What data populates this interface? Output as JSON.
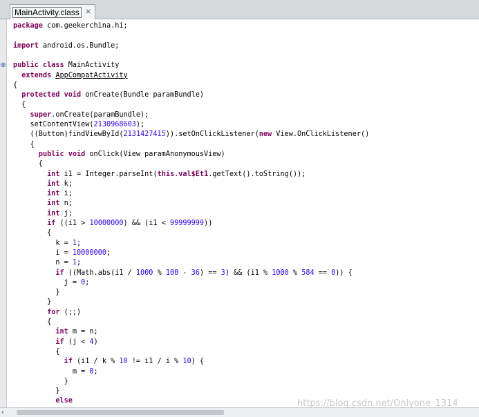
{
  "tab": {
    "title": "MainActivity.class",
    "close_glyph": "×"
  },
  "code": [
    [
      [
        "kw",
        "package"
      ],
      [
        "plain",
        " com.geekerchina.hi;"
      ]
    ],
    [],
    [
      [
        "kw",
        "import"
      ],
      [
        "plain",
        " android.os.Bundle;"
      ]
    ],
    [],
    [
      [
        "kw",
        "public class"
      ],
      [
        "plain",
        " MainActivity"
      ]
    ],
    [
      [
        "plain",
        "  "
      ],
      [
        "kw",
        "extends"
      ],
      [
        "plain",
        " "
      ],
      [
        "under",
        "AppCompatActivity"
      ]
    ],
    [
      [
        "plain",
        "{"
      ]
    ],
    [
      [
        "plain",
        "  "
      ],
      [
        "kw",
        "protected void"
      ],
      [
        "plain",
        " onCreate(Bundle paramBundle)"
      ]
    ],
    [
      [
        "plain",
        "  {"
      ]
    ],
    [
      [
        "plain",
        "    "
      ],
      [
        "kw",
        "super"
      ],
      [
        "plain",
        ".onCreate(paramBundle);"
      ]
    ],
    [
      [
        "plain",
        "    setContentView("
      ],
      [
        "num",
        "2130968603"
      ],
      [
        "plain",
        ");"
      ]
    ],
    [
      [
        "plain",
        "    ((Button)findViewById("
      ],
      [
        "num",
        "2131427415"
      ],
      [
        "plain",
        ")).setOnClickListener("
      ],
      [
        "kw",
        "new"
      ],
      [
        "plain",
        " View.OnClickListener()"
      ]
    ],
    [
      [
        "plain",
        "    {"
      ]
    ],
    [
      [
        "plain",
        "      "
      ],
      [
        "kw",
        "public void"
      ],
      [
        "plain",
        " onClick(View paramAnonymousView)"
      ]
    ],
    [
      [
        "plain",
        "      {"
      ]
    ],
    [
      [
        "plain",
        "        "
      ],
      [
        "kw",
        "int"
      ],
      [
        "plain",
        " i1 = Integer."
      ],
      [
        "plain",
        "parseInt"
      ],
      [
        "plain",
        "("
      ],
      [
        "kw",
        "this"
      ],
      [
        "plain",
        "."
      ],
      [
        "kw",
        "val$Et1"
      ],
      [
        "plain",
        ".getText().toString());"
      ]
    ],
    [
      [
        "plain",
        "        "
      ],
      [
        "kw",
        "int"
      ],
      [
        "plain",
        " k;"
      ]
    ],
    [
      [
        "plain",
        "        "
      ],
      [
        "kw",
        "int"
      ],
      [
        "plain",
        " i;"
      ]
    ],
    [
      [
        "plain",
        "        "
      ],
      [
        "kw",
        "int"
      ],
      [
        "plain",
        " n;"
      ]
    ],
    [
      [
        "plain",
        "        "
      ],
      [
        "kw",
        "int"
      ],
      [
        "plain",
        " j;"
      ]
    ],
    [
      [
        "plain",
        "        "
      ],
      [
        "kw",
        "if"
      ],
      [
        "plain",
        " ((i1 > "
      ],
      [
        "num",
        "10000000"
      ],
      [
        "plain",
        ") && (i1 < "
      ],
      [
        "num",
        "99999999"
      ],
      [
        "plain",
        "))"
      ]
    ],
    [
      [
        "plain",
        "        {"
      ]
    ],
    [
      [
        "plain",
        "          k = "
      ],
      [
        "num",
        "1"
      ],
      [
        "plain",
        ";"
      ]
    ],
    [
      [
        "plain",
        "          i = "
      ],
      [
        "num",
        "10000000"
      ],
      [
        "plain",
        ";"
      ]
    ],
    [
      [
        "plain",
        "          n = "
      ],
      [
        "num",
        "1"
      ],
      [
        "plain",
        ";"
      ]
    ],
    [
      [
        "plain",
        "          "
      ],
      [
        "kw",
        "if"
      ],
      [
        "plain",
        " ((Math.abs(i1 / "
      ],
      [
        "num",
        "1000"
      ],
      [
        "plain",
        " % "
      ],
      [
        "num",
        "100"
      ],
      [
        "plain",
        " - "
      ],
      [
        "num",
        "36"
      ],
      [
        "plain",
        ") == "
      ],
      [
        "num",
        "3"
      ],
      [
        "plain",
        ") && (i1 % "
      ],
      [
        "num",
        "1000"
      ],
      [
        "plain",
        " % "
      ],
      [
        "num",
        "584"
      ],
      [
        "plain",
        " == "
      ],
      [
        "num",
        "0"
      ],
      [
        "plain",
        ")) {"
      ]
    ],
    [
      [
        "plain",
        "            j = "
      ],
      [
        "num",
        "0"
      ],
      [
        "plain",
        ";"
      ]
    ],
    [
      [
        "plain",
        "          }"
      ]
    ],
    [
      [
        "plain",
        "        }"
      ]
    ],
    [
      [
        "plain",
        "        "
      ],
      [
        "kw",
        "for"
      ],
      [
        "plain",
        " (;;)"
      ]
    ],
    [
      [
        "plain",
        "        {"
      ]
    ],
    [
      [
        "plain",
        "          "
      ],
      [
        "kw",
        "int"
      ],
      [
        "plain",
        " m = n;"
      ]
    ],
    [
      [
        "plain",
        "          "
      ],
      [
        "kw",
        "if"
      ],
      [
        "plain",
        " (j < "
      ],
      [
        "num",
        "4"
      ],
      [
        "plain",
        ")"
      ]
    ],
    [
      [
        "plain",
        "          {"
      ]
    ],
    [
      [
        "plain",
        "            "
      ],
      [
        "kw",
        "if"
      ],
      [
        "plain",
        " (i1 / k % "
      ],
      [
        "num",
        "10"
      ],
      [
        "plain",
        " != i1 / i % "
      ],
      [
        "num",
        "10"
      ],
      [
        "plain",
        ") {"
      ]
    ],
    [
      [
        "plain",
        "              m = "
      ],
      [
        "num",
        "0"
      ],
      [
        "plain",
        ";"
      ]
    ],
    [
      [
        "plain",
        "            }"
      ]
    ],
    [
      [
        "plain",
        "          }"
      ]
    ],
    [
      [
        "plain",
        "          "
      ],
      [
        "kw",
        "else"
      ]
    ],
    [
      [
        "plain",
        "          {"
      ]
    ]
  ],
  "fold_icon": "⊕",
  "scroll_arrow": "‹",
  "watermark": "https://blog.csdn.net/Onlyone_1314"
}
